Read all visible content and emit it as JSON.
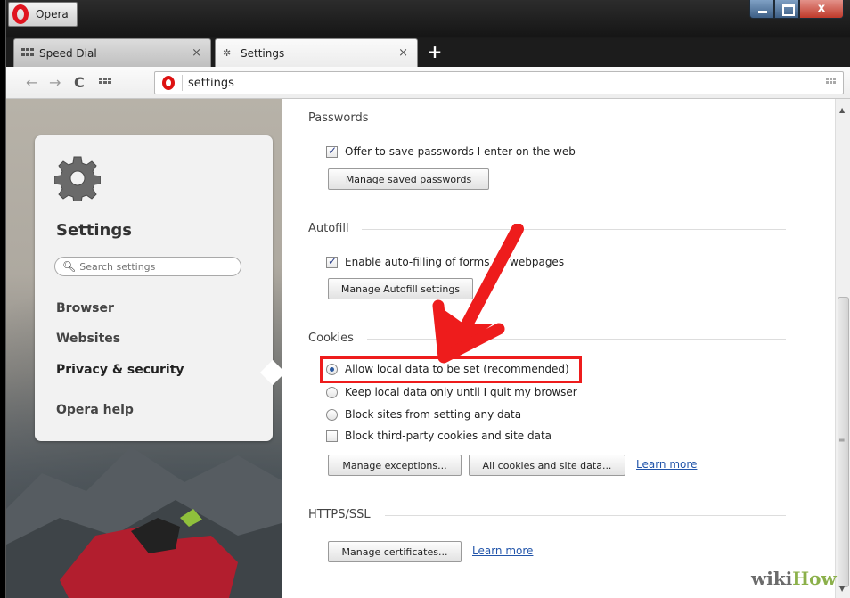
{
  "window": {
    "menu_label": "Opera",
    "controls": {
      "close": "x"
    }
  },
  "tabs": [
    {
      "label": "Speed Dial",
      "close": "×"
    },
    {
      "label": "Settings",
      "close": "×"
    }
  ],
  "new_tab": "+",
  "toolbar": {
    "back": "←",
    "forward": "→",
    "reload": "C",
    "address": "settings"
  },
  "sidebar": {
    "title": "Settings",
    "search_placeholder": "Search settings",
    "items": [
      "Browser",
      "Websites",
      "Privacy & security",
      "Opera help"
    ],
    "active_item": "Privacy & security"
  },
  "sections": {
    "passwords": {
      "title": "Passwords",
      "offer_save": "Offer to save passwords I enter on the web",
      "offer_save_checked": true,
      "manage_button": "Manage saved passwords"
    },
    "autofill": {
      "title": "Autofill",
      "enable": "Enable auto-filling of forms on webpages",
      "enable_checked": true,
      "manage_button": "Manage Autofill settings"
    },
    "cookies": {
      "title": "Cookies",
      "allow": "Allow local data to be set (recommended)",
      "keep_until_quit": "Keep local data only until I quit my browser",
      "block_sites": "Block sites from setting any data",
      "block_third_party": "Block third-party cookies and site data",
      "selected": "allow",
      "third_party_checked": false,
      "exceptions_button": "Manage exceptions...",
      "all_cookies_button": "All cookies and site data...",
      "learn_more": "Learn more"
    },
    "https": {
      "title": "HTTPS/SSL",
      "certificates_button": "Manage certificates...",
      "learn_more": "Learn more"
    }
  },
  "annotation": {
    "highlight_color": "#ee1c1c",
    "arrow_color": "#ee1c1c"
  },
  "watermark": {
    "wiki": "wiki",
    "how": "How"
  }
}
